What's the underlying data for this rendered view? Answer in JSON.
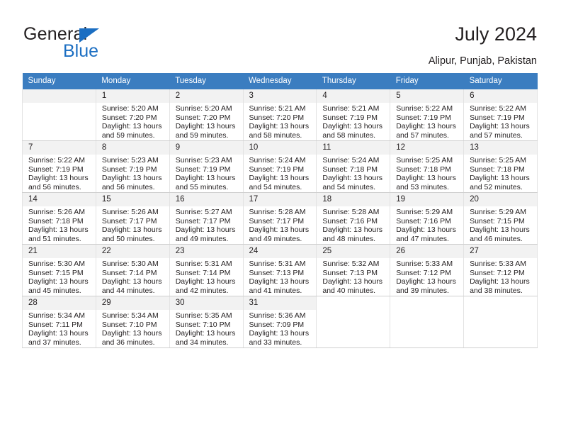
{
  "brand": {
    "name_part1": "General",
    "name_part2": "Blue",
    "triangle_icon": "blue-triangle-icon",
    "accent_color": "#1b6ec2"
  },
  "header": {
    "title": "July 2024",
    "location": "Alipur, Punjab, Pakistan"
  },
  "calendar": {
    "header_bg": "#3b7dc0",
    "daynum_bg": "#f2f2f2",
    "weekdays": [
      "Sunday",
      "Monday",
      "Tuesday",
      "Wednesday",
      "Thursday",
      "Friday",
      "Saturday"
    ],
    "weeks": [
      [
        {
          "day": "",
          "sunrise": "",
          "sunset": "",
          "daylight1": "",
          "daylight2": "",
          "blank": true
        },
        {
          "day": "1",
          "sunrise": "Sunrise: 5:20 AM",
          "sunset": "Sunset: 7:20 PM",
          "daylight1": "Daylight: 13 hours",
          "daylight2": "and 59 minutes."
        },
        {
          "day": "2",
          "sunrise": "Sunrise: 5:20 AM",
          "sunset": "Sunset: 7:20 PM",
          "daylight1": "Daylight: 13 hours",
          "daylight2": "and 59 minutes."
        },
        {
          "day": "3",
          "sunrise": "Sunrise: 5:21 AM",
          "sunset": "Sunset: 7:20 PM",
          "daylight1": "Daylight: 13 hours",
          "daylight2": "and 58 minutes."
        },
        {
          "day": "4",
          "sunrise": "Sunrise: 5:21 AM",
          "sunset": "Sunset: 7:19 PM",
          "daylight1": "Daylight: 13 hours",
          "daylight2": "and 58 minutes."
        },
        {
          "day": "5",
          "sunrise": "Sunrise: 5:22 AM",
          "sunset": "Sunset: 7:19 PM",
          "daylight1": "Daylight: 13 hours",
          "daylight2": "and 57 minutes."
        },
        {
          "day": "6",
          "sunrise": "Sunrise: 5:22 AM",
          "sunset": "Sunset: 7:19 PM",
          "daylight1": "Daylight: 13 hours",
          "daylight2": "and 57 minutes."
        }
      ],
      [
        {
          "day": "7",
          "sunrise": "Sunrise: 5:22 AM",
          "sunset": "Sunset: 7:19 PM",
          "daylight1": "Daylight: 13 hours",
          "daylight2": "and 56 minutes."
        },
        {
          "day": "8",
          "sunrise": "Sunrise: 5:23 AM",
          "sunset": "Sunset: 7:19 PM",
          "daylight1": "Daylight: 13 hours",
          "daylight2": "and 56 minutes."
        },
        {
          "day": "9",
          "sunrise": "Sunrise: 5:23 AM",
          "sunset": "Sunset: 7:19 PM",
          "daylight1": "Daylight: 13 hours",
          "daylight2": "and 55 minutes."
        },
        {
          "day": "10",
          "sunrise": "Sunrise: 5:24 AM",
          "sunset": "Sunset: 7:19 PM",
          "daylight1": "Daylight: 13 hours",
          "daylight2": "and 54 minutes."
        },
        {
          "day": "11",
          "sunrise": "Sunrise: 5:24 AM",
          "sunset": "Sunset: 7:18 PM",
          "daylight1": "Daylight: 13 hours",
          "daylight2": "and 54 minutes."
        },
        {
          "day": "12",
          "sunrise": "Sunrise: 5:25 AM",
          "sunset": "Sunset: 7:18 PM",
          "daylight1": "Daylight: 13 hours",
          "daylight2": "and 53 minutes."
        },
        {
          "day": "13",
          "sunrise": "Sunrise: 5:25 AM",
          "sunset": "Sunset: 7:18 PM",
          "daylight1": "Daylight: 13 hours",
          "daylight2": "and 52 minutes."
        }
      ],
      [
        {
          "day": "14",
          "sunrise": "Sunrise: 5:26 AM",
          "sunset": "Sunset: 7:18 PM",
          "daylight1": "Daylight: 13 hours",
          "daylight2": "and 51 minutes."
        },
        {
          "day": "15",
          "sunrise": "Sunrise: 5:26 AM",
          "sunset": "Sunset: 7:17 PM",
          "daylight1": "Daylight: 13 hours",
          "daylight2": "and 50 minutes."
        },
        {
          "day": "16",
          "sunrise": "Sunrise: 5:27 AM",
          "sunset": "Sunset: 7:17 PM",
          "daylight1": "Daylight: 13 hours",
          "daylight2": "and 49 minutes."
        },
        {
          "day": "17",
          "sunrise": "Sunrise: 5:28 AM",
          "sunset": "Sunset: 7:17 PM",
          "daylight1": "Daylight: 13 hours",
          "daylight2": "and 49 minutes."
        },
        {
          "day": "18",
          "sunrise": "Sunrise: 5:28 AM",
          "sunset": "Sunset: 7:16 PM",
          "daylight1": "Daylight: 13 hours",
          "daylight2": "and 48 minutes."
        },
        {
          "day": "19",
          "sunrise": "Sunrise: 5:29 AM",
          "sunset": "Sunset: 7:16 PM",
          "daylight1": "Daylight: 13 hours",
          "daylight2": "and 47 minutes."
        },
        {
          "day": "20",
          "sunrise": "Sunrise: 5:29 AM",
          "sunset": "Sunset: 7:15 PM",
          "daylight1": "Daylight: 13 hours",
          "daylight2": "and 46 minutes."
        }
      ],
      [
        {
          "day": "21",
          "sunrise": "Sunrise: 5:30 AM",
          "sunset": "Sunset: 7:15 PM",
          "daylight1": "Daylight: 13 hours",
          "daylight2": "and 45 minutes."
        },
        {
          "day": "22",
          "sunrise": "Sunrise: 5:30 AM",
          "sunset": "Sunset: 7:14 PM",
          "daylight1": "Daylight: 13 hours",
          "daylight2": "and 44 minutes."
        },
        {
          "day": "23",
          "sunrise": "Sunrise: 5:31 AM",
          "sunset": "Sunset: 7:14 PM",
          "daylight1": "Daylight: 13 hours",
          "daylight2": "and 42 minutes."
        },
        {
          "day": "24",
          "sunrise": "Sunrise: 5:31 AM",
          "sunset": "Sunset: 7:13 PM",
          "daylight1": "Daylight: 13 hours",
          "daylight2": "and 41 minutes."
        },
        {
          "day": "25",
          "sunrise": "Sunrise: 5:32 AM",
          "sunset": "Sunset: 7:13 PM",
          "daylight1": "Daylight: 13 hours",
          "daylight2": "and 40 minutes."
        },
        {
          "day": "26",
          "sunrise": "Sunrise: 5:33 AM",
          "sunset": "Sunset: 7:12 PM",
          "daylight1": "Daylight: 13 hours",
          "daylight2": "and 39 minutes."
        },
        {
          "day": "27",
          "sunrise": "Sunrise: 5:33 AM",
          "sunset": "Sunset: 7:12 PM",
          "daylight1": "Daylight: 13 hours",
          "daylight2": "and 38 minutes."
        }
      ],
      [
        {
          "day": "28",
          "sunrise": "Sunrise: 5:34 AM",
          "sunset": "Sunset: 7:11 PM",
          "daylight1": "Daylight: 13 hours",
          "daylight2": "and 37 minutes."
        },
        {
          "day": "29",
          "sunrise": "Sunrise: 5:34 AM",
          "sunset": "Sunset: 7:10 PM",
          "daylight1": "Daylight: 13 hours",
          "daylight2": "and 36 minutes."
        },
        {
          "day": "30",
          "sunrise": "Sunrise: 5:35 AM",
          "sunset": "Sunset: 7:10 PM",
          "daylight1": "Daylight: 13 hours",
          "daylight2": "and 34 minutes."
        },
        {
          "day": "31",
          "sunrise": "Sunrise: 5:36 AM",
          "sunset": "Sunset: 7:09 PM",
          "daylight1": "Daylight: 13 hours",
          "daylight2": "and 33 minutes."
        },
        {
          "day": "",
          "sunrise": "",
          "sunset": "",
          "daylight1": "",
          "daylight2": "",
          "empty": true
        },
        {
          "day": "",
          "sunrise": "",
          "sunset": "",
          "daylight1": "",
          "daylight2": "",
          "empty": true
        },
        {
          "day": "",
          "sunrise": "",
          "sunset": "",
          "daylight1": "",
          "daylight2": "",
          "empty": true
        }
      ]
    ]
  }
}
